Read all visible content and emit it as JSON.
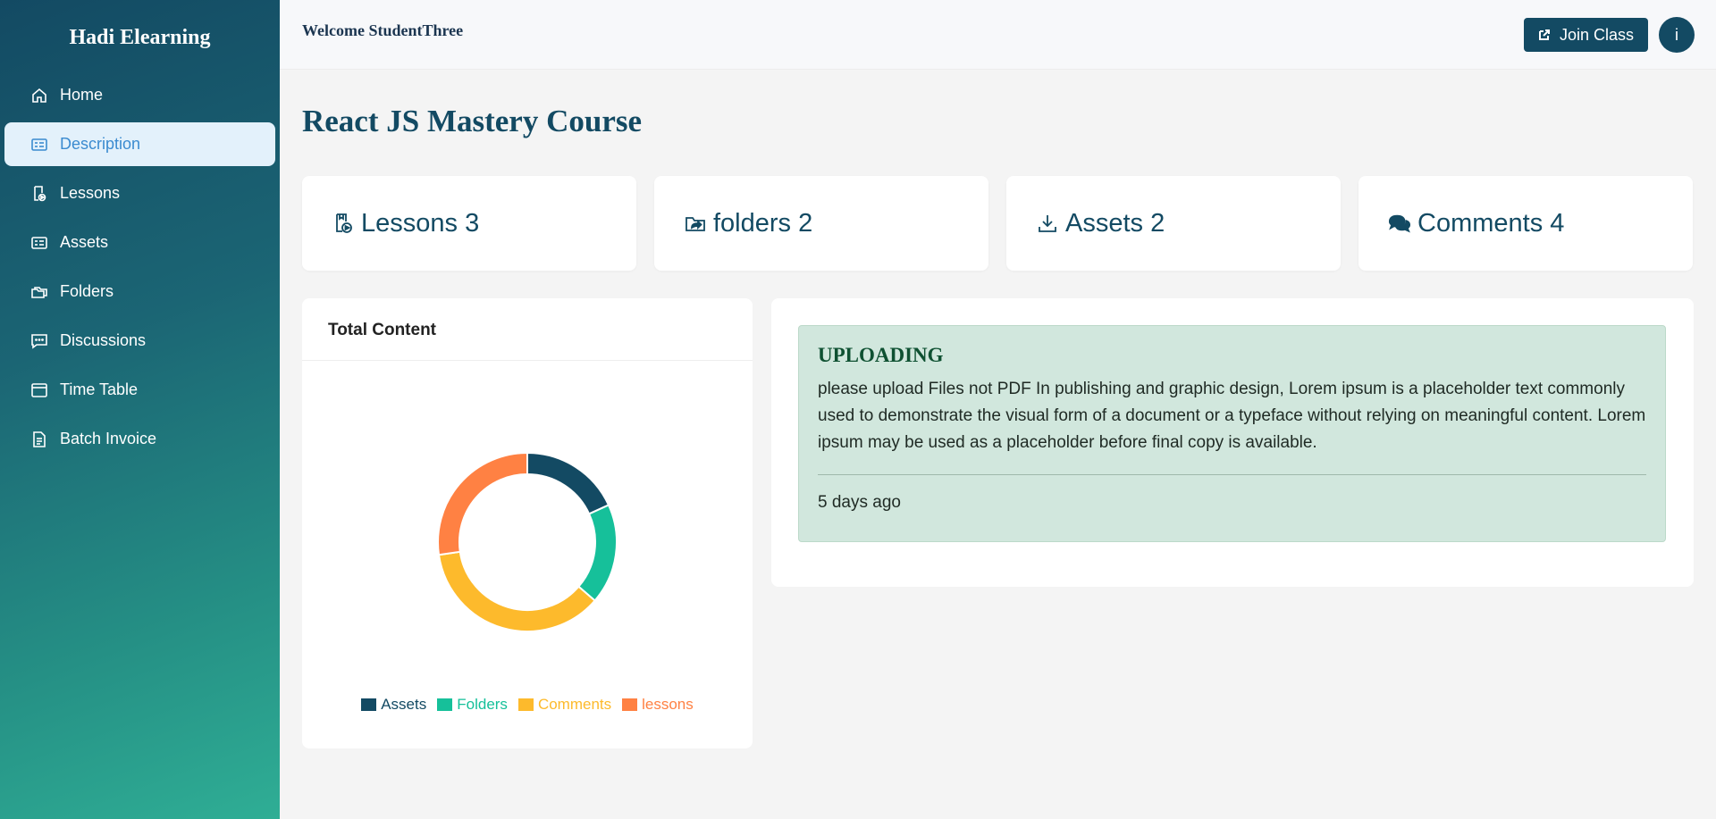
{
  "sidebar": {
    "brand": "Hadi Elearning",
    "items": [
      {
        "label": "Home",
        "icon": "home-icon"
      },
      {
        "label": "Description",
        "icon": "description-icon",
        "active": true
      },
      {
        "label": "Lessons",
        "icon": "lessons-icon"
      },
      {
        "label": "Assets",
        "icon": "assets-icon"
      },
      {
        "label": "Folders",
        "icon": "folders-icon"
      },
      {
        "label": "Discussions",
        "icon": "discussions-icon"
      },
      {
        "label": "Time Table",
        "icon": "calendar-icon"
      },
      {
        "label": "Batch Invoice",
        "icon": "invoice-icon"
      }
    ]
  },
  "header": {
    "welcome": "Welcome StudentThree",
    "join_label": "Join Class",
    "avatar_letter": "i"
  },
  "main": {
    "title": "React JS Mastery Course",
    "stats": [
      {
        "label": "Lessons 3",
        "icon": "lesson-play-icon"
      },
      {
        "label": "folders 2",
        "icon": "folder-share-icon"
      },
      {
        "label": "Assets 2",
        "icon": "download-icon"
      },
      {
        "label": "Comments 4",
        "icon": "comments-icon"
      }
    ],
    "chart_title": "Total Content",
    "notice": {
      "title": "UPLOADING",
      "body": "please upload Files not PDF In publishing and graphic design, Lorem ipsum is a placeholder text commonly used to demonstrate the visual form of a document or a typeface without relying on meaningful content. Lorem ipsum may be used as a placeholder before final copy is available.",
      "time": "5 days ago"
    }
  },
  "colors": {
    "primary": "#134a63",
    "accent_active": "#3b8bd0",
    "assets": "#134a63",
    "folders": "#16c09a",
    "comments": "#fdba2c",
    "lessons": "#ff8143",
    "notice_bg": "#d1e7dd"
  },
  "chart_data": {
    "type": "pie",
    "donut": true,
    "title": "Total Content",
    "categories": [
      "Assets",
      "Folders",
      "Comments",
      "lessons"
    ],
    "values": [
      2,
      2,
      4,
      3
    ],
    "colors": [
      "#134a63",
      "#16c09a",
      "#fdba2c",
      "#ff8143"
    ],
    "legend": "bottom"
  }
}
